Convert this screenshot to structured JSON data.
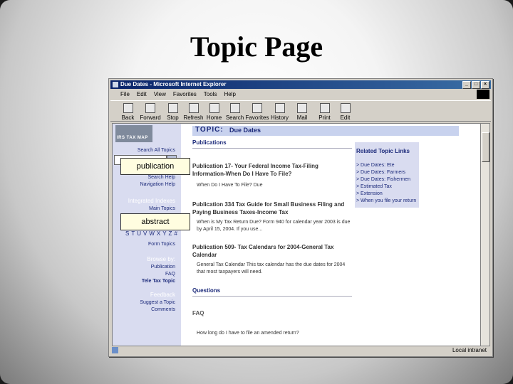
{
  "slide": {
    "title": "Topic Page"
  },
  "browser": {
    "window_title": "Due Dates - Microsoft Internet Explorer",
    "menu": [
      "File",
      "Edit",
      "View",
      "Favorites",
      "Tools",
      "Help"
    ],
    "toolbar": [
      "Back",
      "Forward",
      "Stop",
      "Refresh",
      "Home",
      "Search",
      "Favorites",
      "History",
      "Mail",
      "Print",
      "Edit"
    ],
    "status_zone": "Local intranet"
  },
  "nav": {
    "logo_text": "IRS TAX MAP",
    "search_label": "Search All Topics",
    "search_help": "Search Help",
    "navigation_help": "Navigation Help",
    "integrated_indexes": "Integrated Indexes",
    "main_topics": "Main Topics",
    "alphabet": "STUVWXYZ#",
    "form_topics": "Form Topics",
    "browse_by": "Browse by:",
    "browse_items": [
      "Publication",
      "FAQ",
      "Tele Tax Topic"
    ],
    "feedback": "Feedback",
    "suggest_topic": "Suggest a Topic",
    "comments": "Comments"
  },
  "overlays": {
    "publication": "publication",
    "abstract": "abstract"
  },
  "main": {
    "topic_label": "TOPIC:",
    "topic_name": "Due Dates",
    "publications_heading": "Publications",
    "pubs": [
      {
        "title": "Publication 17- Your Federal Income Tax-Filing Information-When Do I Have To File?",
        "abstract": "When Do I Have To File? Due"
      },
      {
        "title": "Publication 334 Tax Guide for Small Business Filing and Paying Business Taxes-Income Tax",
        "abstract": "When is My Tax Return Due? Form 940 for calendar year 2003 is due by April 15, 2004. If you use..."
      },
      {
        "title": "Publication 509- Tax Calendars for 2004-General Tax Calendar",
        "abstract": "General Tax Calendar This tax calendar has the due dates for 2004 that most taxpayers will need."
      }
    ],
    "questions_heading": "Questions",
    "faq_heading": "FAQ",
    "faq_item": "How long do I have to file an amended return?",
    "related_title": "Related Topic Links",
    "related_links": [
      "> Due Dates: Ete",
      "> Due Dates: Farmers",
      "> Due Dates: Fishermen",
      "> Estimated Tax",
      "> Extension",
      "> When you file your return"
    ]
  }
}
